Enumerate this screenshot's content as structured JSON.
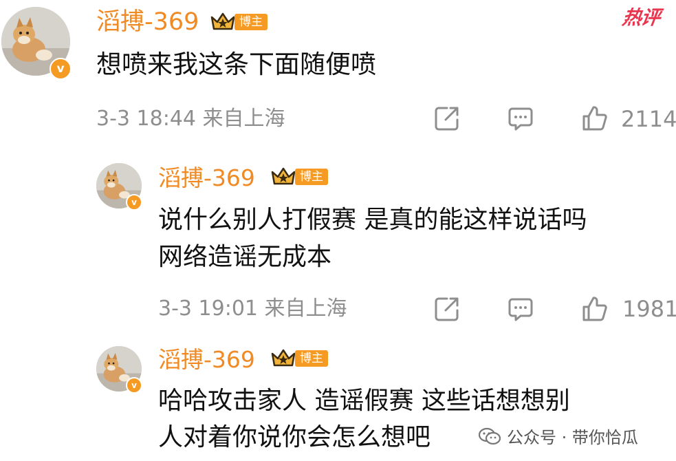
{
  "hot_label": "热评",
  "blogger_tag": "博主",
  "verified_badge": "v",
  "comments": [
    {
      "username": "滔搏-369",
      "lines": [
        "想喷来我这条下面随便喷"
      ],
      "meta": "3-3 18:44 来自上海",
      "likes": "2114"
    },
    {
      "username": "滔搏-369",
      "lines": [
        "说什么别人打假赛  是真的能这样说话吗",
        "网络造谣无成本"
      ],
      "meta": "3-3 19:01 来自上海",
      "likes": "1981"
    },
    {
      "username": "滔搏-369",
      "lines": [
        "哈哈攻击家人 造谣假赛  这些话想想别",
        "人对着你说你会怎么想吧"
      ]
    }
  ],
  "watermark": {
    "text": "公众号 · 带你恰瓜",
    "icon": "wechat-icon"
  },
  "icons": {
    "share": "share-icon",
    "comment": "comment-icon",
    "like": "thumbs-up-icon"
  },
  "colors": {
    "username": "#f08a24",
    "badge": "#f59a23",
    "hot": "#e8364f",
    "meta": "#8e8e8e"
  }
}
